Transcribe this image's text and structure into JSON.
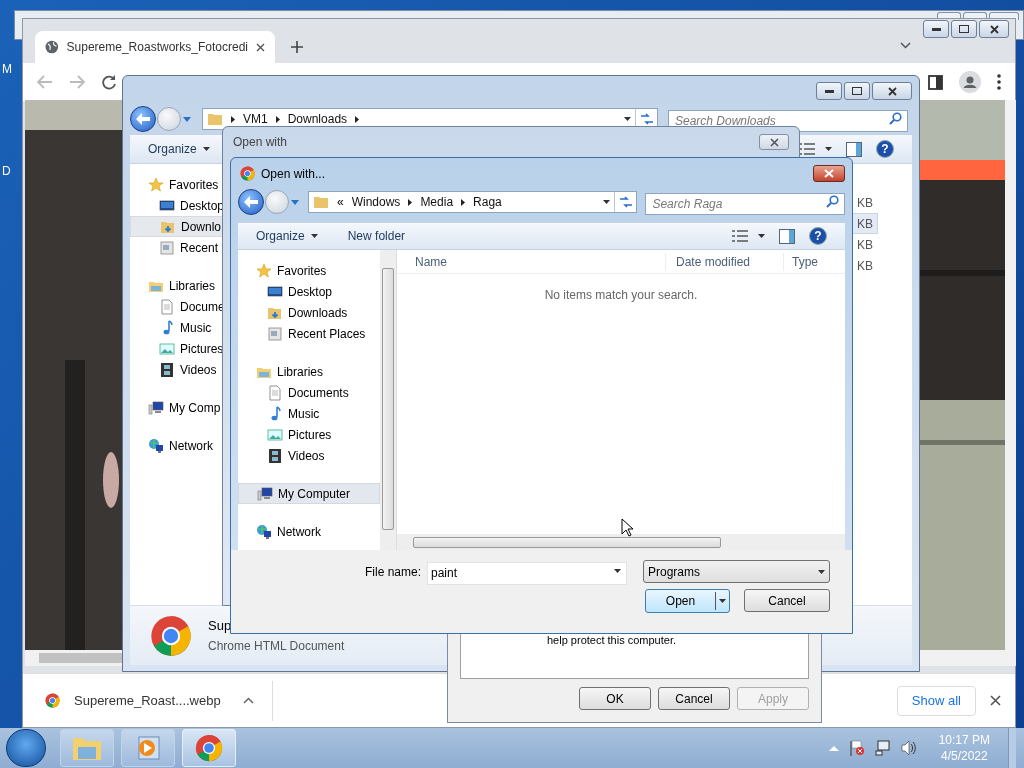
{
  "desktop": {
    "icon_labels": [
      "M",
      "D"
    ]
  },
  "browser": {
    "tab": {
      "title": "Supereme_Roastworks_Fotocredi",
      "selected": true
    },
    "download": {
      "filename": "Supereme_Roast....webp"
    },
    "show_all": "Show all"
  },
  "explorer": {
    "path": [
      "VM1",
      "Downloads"
    ],
    "search_placeholder": "Search Downloads",
    "toolbar": [
      {
        "label": "Organize",
        "menu": true
      }
    ],
    "nav": [
      {
        "label": "Favorites",
        "kind": "star",
        "children": [
          {
            "label": "Desktop",
            "kind": "desktop",
            "selected": false
          },
          {
            "label": "Downlo",
            "kind": "downloads",
            "selected": true
          },
          {
            "label": "Recent",
            "kind": "recent",
            "selected": false
          }
        ]
      },
      {
        "label": "Libraries",
        "kind": "library",
        "children": [
          {
            "label": "Docume",
            "kind": "document",
            "selected": false
          },
          {
            "label": "Music",
            "kind": "music",
            "selected": false
          },
          {
            "label": "Pictures",
            "kind": "pictures",
            "selected": false
          },
          {
            "label": "Videos",
            "kind": "videos",
            "selected": false
          }
        ]
      },
      {
        "label": "My Comp",
        "kind": "computer"
      },
      {
        "label": "Network",
        "kind": "network"
      }
    ],
    "help_label": "?",
    "sizes": [
      {
        "text": "KB",
        "selected": false
      },
      {
        "text": "KB",
        "selected": true
      },
      {
        "text": "KB",
        "selected": false
      },
      {
        "text": "KB",
        "selected": false
      }
    ],
    "details": {
      "name": "Sup",
      "type": "Chrome HTML Document"
    }
  },
  "open_with": {
    "title": "Open with"
  },
  "properties": {
    "message": "help protect this computer.",
    "buttons": [
      {
        "label": "OK",
        "disabled": false
      },
      {
        "label": "Cancel",
        "disabled": false
      },
      {
        "label": "Apply",
        "disabled": true
      }
    ]
  },
  "dialog": {
    "title": "Open with...",
    "path_overflow": "«",
    "path": [
      "Windows",
      "Media",
      "Raga"
    ],
    "help_label": "?",
    "search_placeholder": "Search Raga",
    "toolbar": [
      {
        "label": "Organize",
        "menu": true
      },
      {
        "label": "New folder",
        "menu": false
      }
    ],
    "nav": [
      {
        "label": "Favorites",
        "kind": "star",
        "selected": false,
        "children": [
          {
            "label": "Desktop",
            "kind": "desktop",
            "selected": false
          },
          {
            "label": "Downloads",
            "kind": "downloads",
            "selected": false
          },
          {
            "label": "Recent Places",
            "kind": "recent",
            "selected": false
          }
        ]
      },
      {
        "label": "Libraries",
        "kind": "library",
        "selected": false,
        "children": [
          {
            "label": "Documents",
            "kind": "document",
            "selected": false
          },
          {
            "label": "Music",
            "kind": "music",
            "selected": false
          },
          {
            "label": "Pictures",
            "kind": "pictures",
            "selected": false
          },
          {
            "label": "Videos",
            "kind": "videos",
            "selected": false
          }
        ]
      },
      {
        "label": "My Computer",
        "kind": "computer",
        "selected": true
      },
      {
        "label": "Network",
        "kind": "network",
        "selected": false
      }
    ],
    "columns": [
      "Name",
      "Date modified",
      "Type"
    ],
    "empty_message": "No items match your search.",
    "file_name_label": "File name:",
    "file_name": "paint",
    "file_type": "Programs",
    "buttons": [
      "Open",
      "Cancel"
    ]
  },
  "taskbar": {
    "apps": [
      {
        "kind": "explorer",
        "selected": false
      },
      {
        "kind": "media",
        "selected": false
      },
      {
        "kind": "chrome",
        "selected": true
      }
    ],
    "time": "10:17 PM",
    "date": "4/5/2022"
  }
}
